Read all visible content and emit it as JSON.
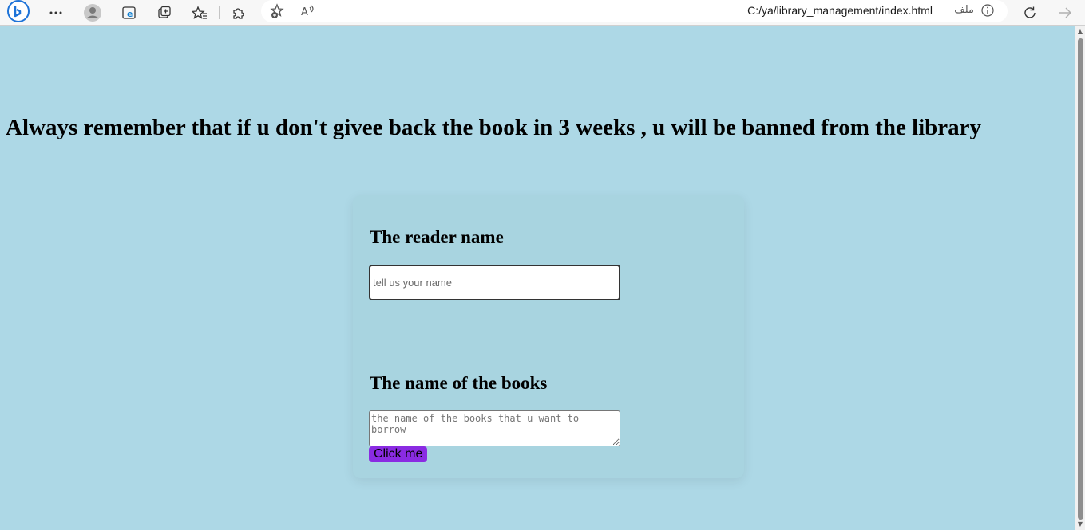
{
  "browser": {
    "url": "C:/ya/library_management/index.html",
    "file_label": "ملف",
    "icons": [
      "bing-copilot-icon",
      "more-icon",
      "profile-icon",
      "edge-icon",
      "collections-icon",
      "favorites-icon",
      "extensions-icon",
      "add-favorite-icon",
      "read-aloud-icon",
      "info-icon",
      "refresh-icon",
      "forward-icon"
    ]
  },
  "page": {
    "banner": "Always remember that if u don't givee back the book in 3 weeks , u will be banned from the library",
    "reader_label": "The reader name",
    "reader_placeholder": "tell us your name",
    "books_label": "The name of the books",
    "books_placeholder": "the name of the books that u want to borrow",
    "button_label": "Click me"
  },
  "colors": {
    "background": "#add8e6",
    "card": "#a8d4e0",
    "button": "#8a2be2"
  }
}
